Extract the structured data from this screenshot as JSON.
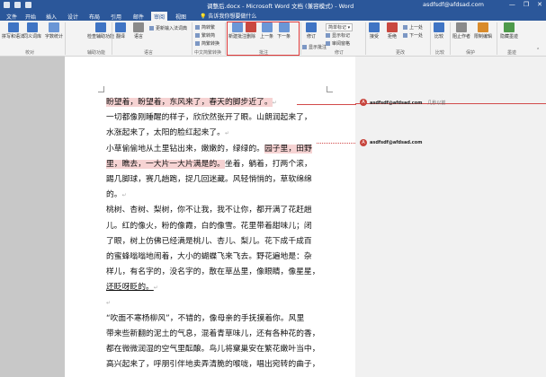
{
  "window": {
    "title": "调整后.docx - Microsoft Word 文档 (兼容模式) - Word",
    "user": "asdfsdf@afdsad.com",
    "controls": [
      "—",
      "❐",
      "✕"
    ]
  },
  "tabs": [
    "文件",
    "开始",
    "插入",
    "设计",
    "布局",
    "引用",
    "邮件",
    "审阅",
    "视图",
    "帮助"
  ],
  "active_tab": "审阅",
  "tell_me": "告诉我你想要做什么",
  "ribbon": {
    "proofing": {
      "spell": "拼写和语法",
      "thesaurus": "同义词库",
      "wordcount": "字数统计",
      "label": "校对"
    },
    "accessibility": {
      "check": "检查辅助功能",
      "label": "辅助功能"
    },
    "language": {
      "translate": "翻译",
      "language": "语言",
      "update_input": "更新输入法词典",
      "label": "语言"
    },
    "chinese": {
      "s2t": "简转繁",
      "t2s": "繁转简",
      "convert": "简繁转换",
      "label": "中文简繁转换"
    },
    "comments": {
      "new": "新建批注",
      "delete": "删除",
      "prev": "上一条",
      "next": "下一条",
      "show": "显示批注",
      "label": "批注"
    },
    "tracking": {
      "track": "修订",
      "markup": "简单标记",
      "show_markup": "显示标记",
      "pane": "审阅窗格",
      "label": "修订"
    },
    "changes": {
      "accept": "接受",
      "reject": "拒绝",
      "prev": "上一处",
      "next": "下一处",
      "label": "更改"
    },
    "compare": {
      "compare": "比较",
      "label": "比较"
    },
    "protect": {
      "block": "阻止作者",
      "restrict": "限制编辑",
      "label": "保护"
    },
    "ink": {
      "hide": "隐藏墨迹",
      "label": "墨迹"
    }
  },
  "document": {
    "lines": [
      "盼望着，盼望着，东风来了，春天的脚步近了。",
      "一切都像刚睡醒的样子，欣欣然张开了眼。山朗润起来了，",
      "水涨起来了，太阳的脸红起来了。",
      "小草偷偷地从土里钻出来，嫩嫩的，绿绿的。园子里，田野",
      "里，瞧去，一大片一大片满是的。坐着，躺着，打两个滚，",
      "踢几脚球，赛几趟跑，捉几回迷藏。风轻悄悄的，草软绵绵",
      "的。",
      "桃树、杏树、梨树，你不让我，我不让你，都开满了花赶趟",
      "儿。红的像火，粉的像霞，白的像雪。花里带着甜味儿；闭",
      "了眼，树上仿佛已经满是桃儿、杏儿、梨儿。花下成千成百",
      "的蜜蜂嗡嗡地闹着，大小的蝴蝶飞来飞去。野花遍地是：杂",
      "样儿，有名字的，没名字的，散在草丛里，像眼睛，像星星，",
      "还眨呀眨的。",
      "",
      "“吹面不寒杨柳风”，不错的，像母亲的手抚摸着你。风里",
      "带来些新翻的泥土的气息，混着青草味儿，还有各种花的香，",
      "都在微微润湿的空气里酝酿。鸟儿将窠巢安在繁花嫩叶当中，",
      "高兴起来了，呼朋引伴地卖弄清脆的喉咙，唱出宛转的曲子，"
    ]
  },
  "comments": [
    {
      "initial": "A",
      "author": "asdfsdf@afdsad.com",
      "time": "几秒以前",
      "text": ""
    },
    {
      "initial": "A",
      "author": "asdfsdf@afdsad.com",
      "time": "",
      "text": ""
    }
  ]
}
